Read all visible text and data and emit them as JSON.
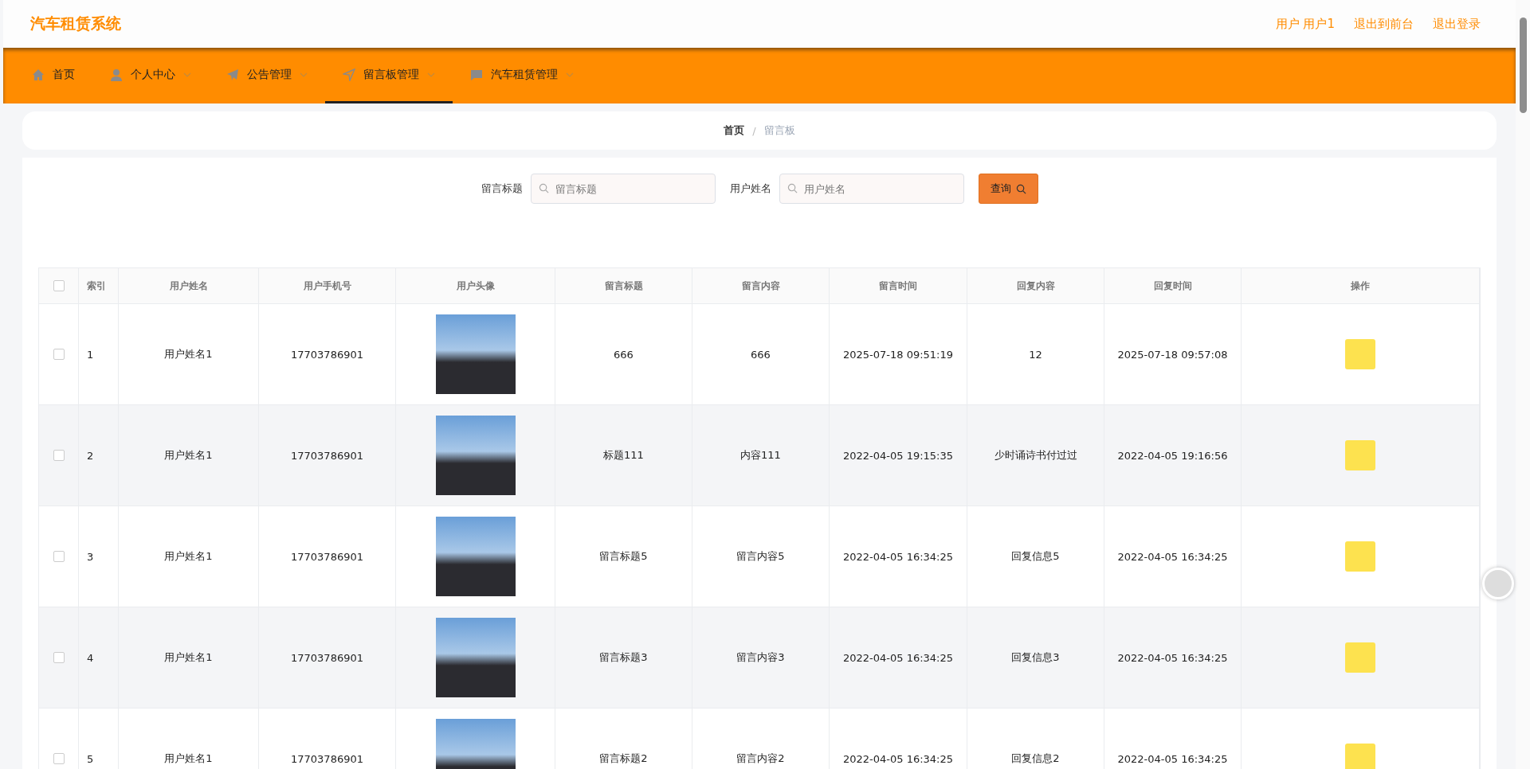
{
  "header": {
    "title": "汽车租赁系统",
    "links": [
      "用户 用户1",
      "退出到前台",
      "退出登录"
    ]
  },
  "nav": [
    {
      "label": "首页",
      "dropdown": false,
      "selected": false
    },
    {
      "label": "个人中心",
      "dropdown": true,
      "selected": false
    },
    {
      "label": "公告管理",
      "dropdown": true,
      "selected": false
    },
    {
      "label": "留言板管理",
      "dropdown": true,
      "selected": true
    },
    {
      "label": "汽车租赁管理",
      "dropdown": true,
      "selected": false
    }
  ],
  "breadcrumb": [
    "首页",
    "/",
    "留言板"
  ],
  "search": {
    "fields": [
      {
        "label": "留言标题",
        "placeholder": "留言标题"
      },
      {
        "label": "用户姓名",
        "placeholder": "用户姓名"
      }
    ],
    "button": "查询"
  },
  "table": {
    "all_checked": false,
    "columns": [
      "索引",
      "用户姓名",
      "用户手机号",
      "用户头像",
      "留言标题",
      "留言内容",
      "留言时间",
      "回复内容",
      "回复时间",
      "操作"
    ],
    "rows": [
      {
        "checked": false,
        "cells": [
          "1",
          "用户姓名1",
          "17703786901",
          "",
          "666",
          "666",
          "2025-07-18 09:51:19",
          "12",
          "2025-07-18 09:57:08"
        ]
      },
      {
        "checked": false,
        "cells": [
          "2",
          "用户姓名1",
          "17703786901",
          "",
          "标题111",
          "内容111",
          "2022-04-05 19:15:35",
          "少时诵诗书付过过",
          "2022-04-05 19:16:56"
        ]
      },
      {
        "checked": false,
        "cells": [
          "3",
          "用户姓名1",
          "17703786901",
          "",
          "留言标题5",
          "留言内容5",
          "2022-04-05 16:34:25",
          "回复信息5",
          "2022-04-05 16:34:25"
        ]
      },
      {
        "checked": false,
        "cells": [
          "4",
          "用户姓名1",
          "17703786901",
          "",
          "留言标题3",
          "留言内容3",
          "2022-04-05 16:34:25",
          "回复信息3",
          "2022-04-05 16:34:25"
        ]
      },
      {
        "checked": false,
        "cells": [
          "5",
          "用户姓名1",
          "17703786901",
          "",
          "留言标题2",
          "留言内容2",
          "2022-04-05 16:34:25",
          "回复信息2",
          "2022-04-05 16:34:25"
        ]
      }
    ]
  }
}
